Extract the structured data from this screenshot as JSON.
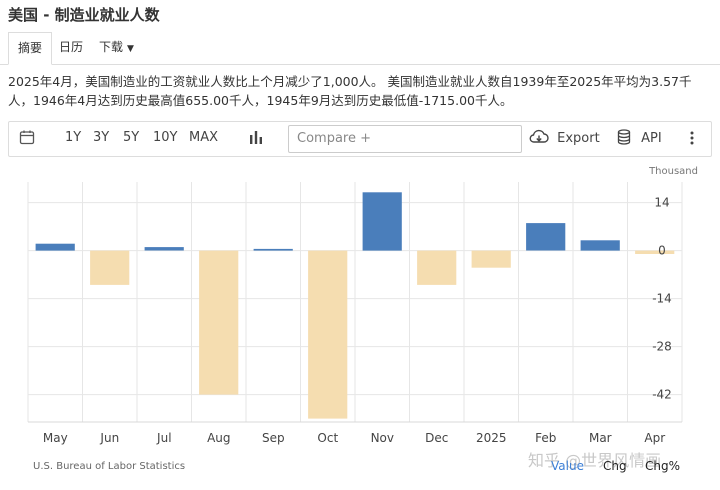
{
  "page": {
    "title": "美国 - 制造业就业人数",
    "tabs": [
      {
        "label": "摘要",
        "active": true
      },
      {
        "label": "日历"
      },
      {
        "label": "下载",
        "has_caret": true
      }
    ],
    "summary_line1": "2025年4月，美国制造业的工资就业人数比上个月减少了1,000人。 美国制造业就业人数自1939年至2025年平均为3.57千",
    "summary_line2": "人，1946年4月达到历史最高值655.00千人，1945年9月达到历史最低值-1715.00千人。"
  },
  "toolbar": {
    "calendar_icon": "calendar-icon",
    "ranges": [
      "1Y",
      "3Y",
      "5Y",
      "10Y",
      "MAX"
    ],
    "chart_type_icon": "bar-chart-icon",
    "compare_placeholder": "Compare +",
    "export_icon": "cloud-download-icon",
    "export_label": "Export",
    "api_icon": "database-icon",
    "api_label": "API",
    "more_icon": "vertical-dots-icon"
  },
  "footer": {
    "source": "U.S. Bureau of Labor Statistics",
    "legend_value": "Value",
    "legend_chg": "Chg",
    "legend_chgpct": "Chg%",
    "watermark": "知乎 @世界风情画"
  },
  "colors": {
    "positive": "#4a7ebb",
    "negative": "#f5ddb0",
    "grid": "#e6e6e6",
    "legend_value": "#3c7fd6"
  },
  "chart_data": {
    "type": "bar",
    "unit_label": "Thousand",
    "categories": [
      "May",
      "Jun",
      "Jul",
      "Aug",
      "Sep",
      "Oct",
      "Nov",
      "Dec",
      "2025",
      "Feb",
      "Mar",
      "Apr"
    ],
    "values": [
      2,
      -10,
      1,
      -42,
      0.5,
      -49,
      17,
      -10,
      -5,
      8,
      3,
      -1
    ],
    "yticks": [
      14,
      0,
      -14,
      -28,
      -42
    ],
    "ylim": [
      -50,
      20
    ],
    "grid": true
  }
}
